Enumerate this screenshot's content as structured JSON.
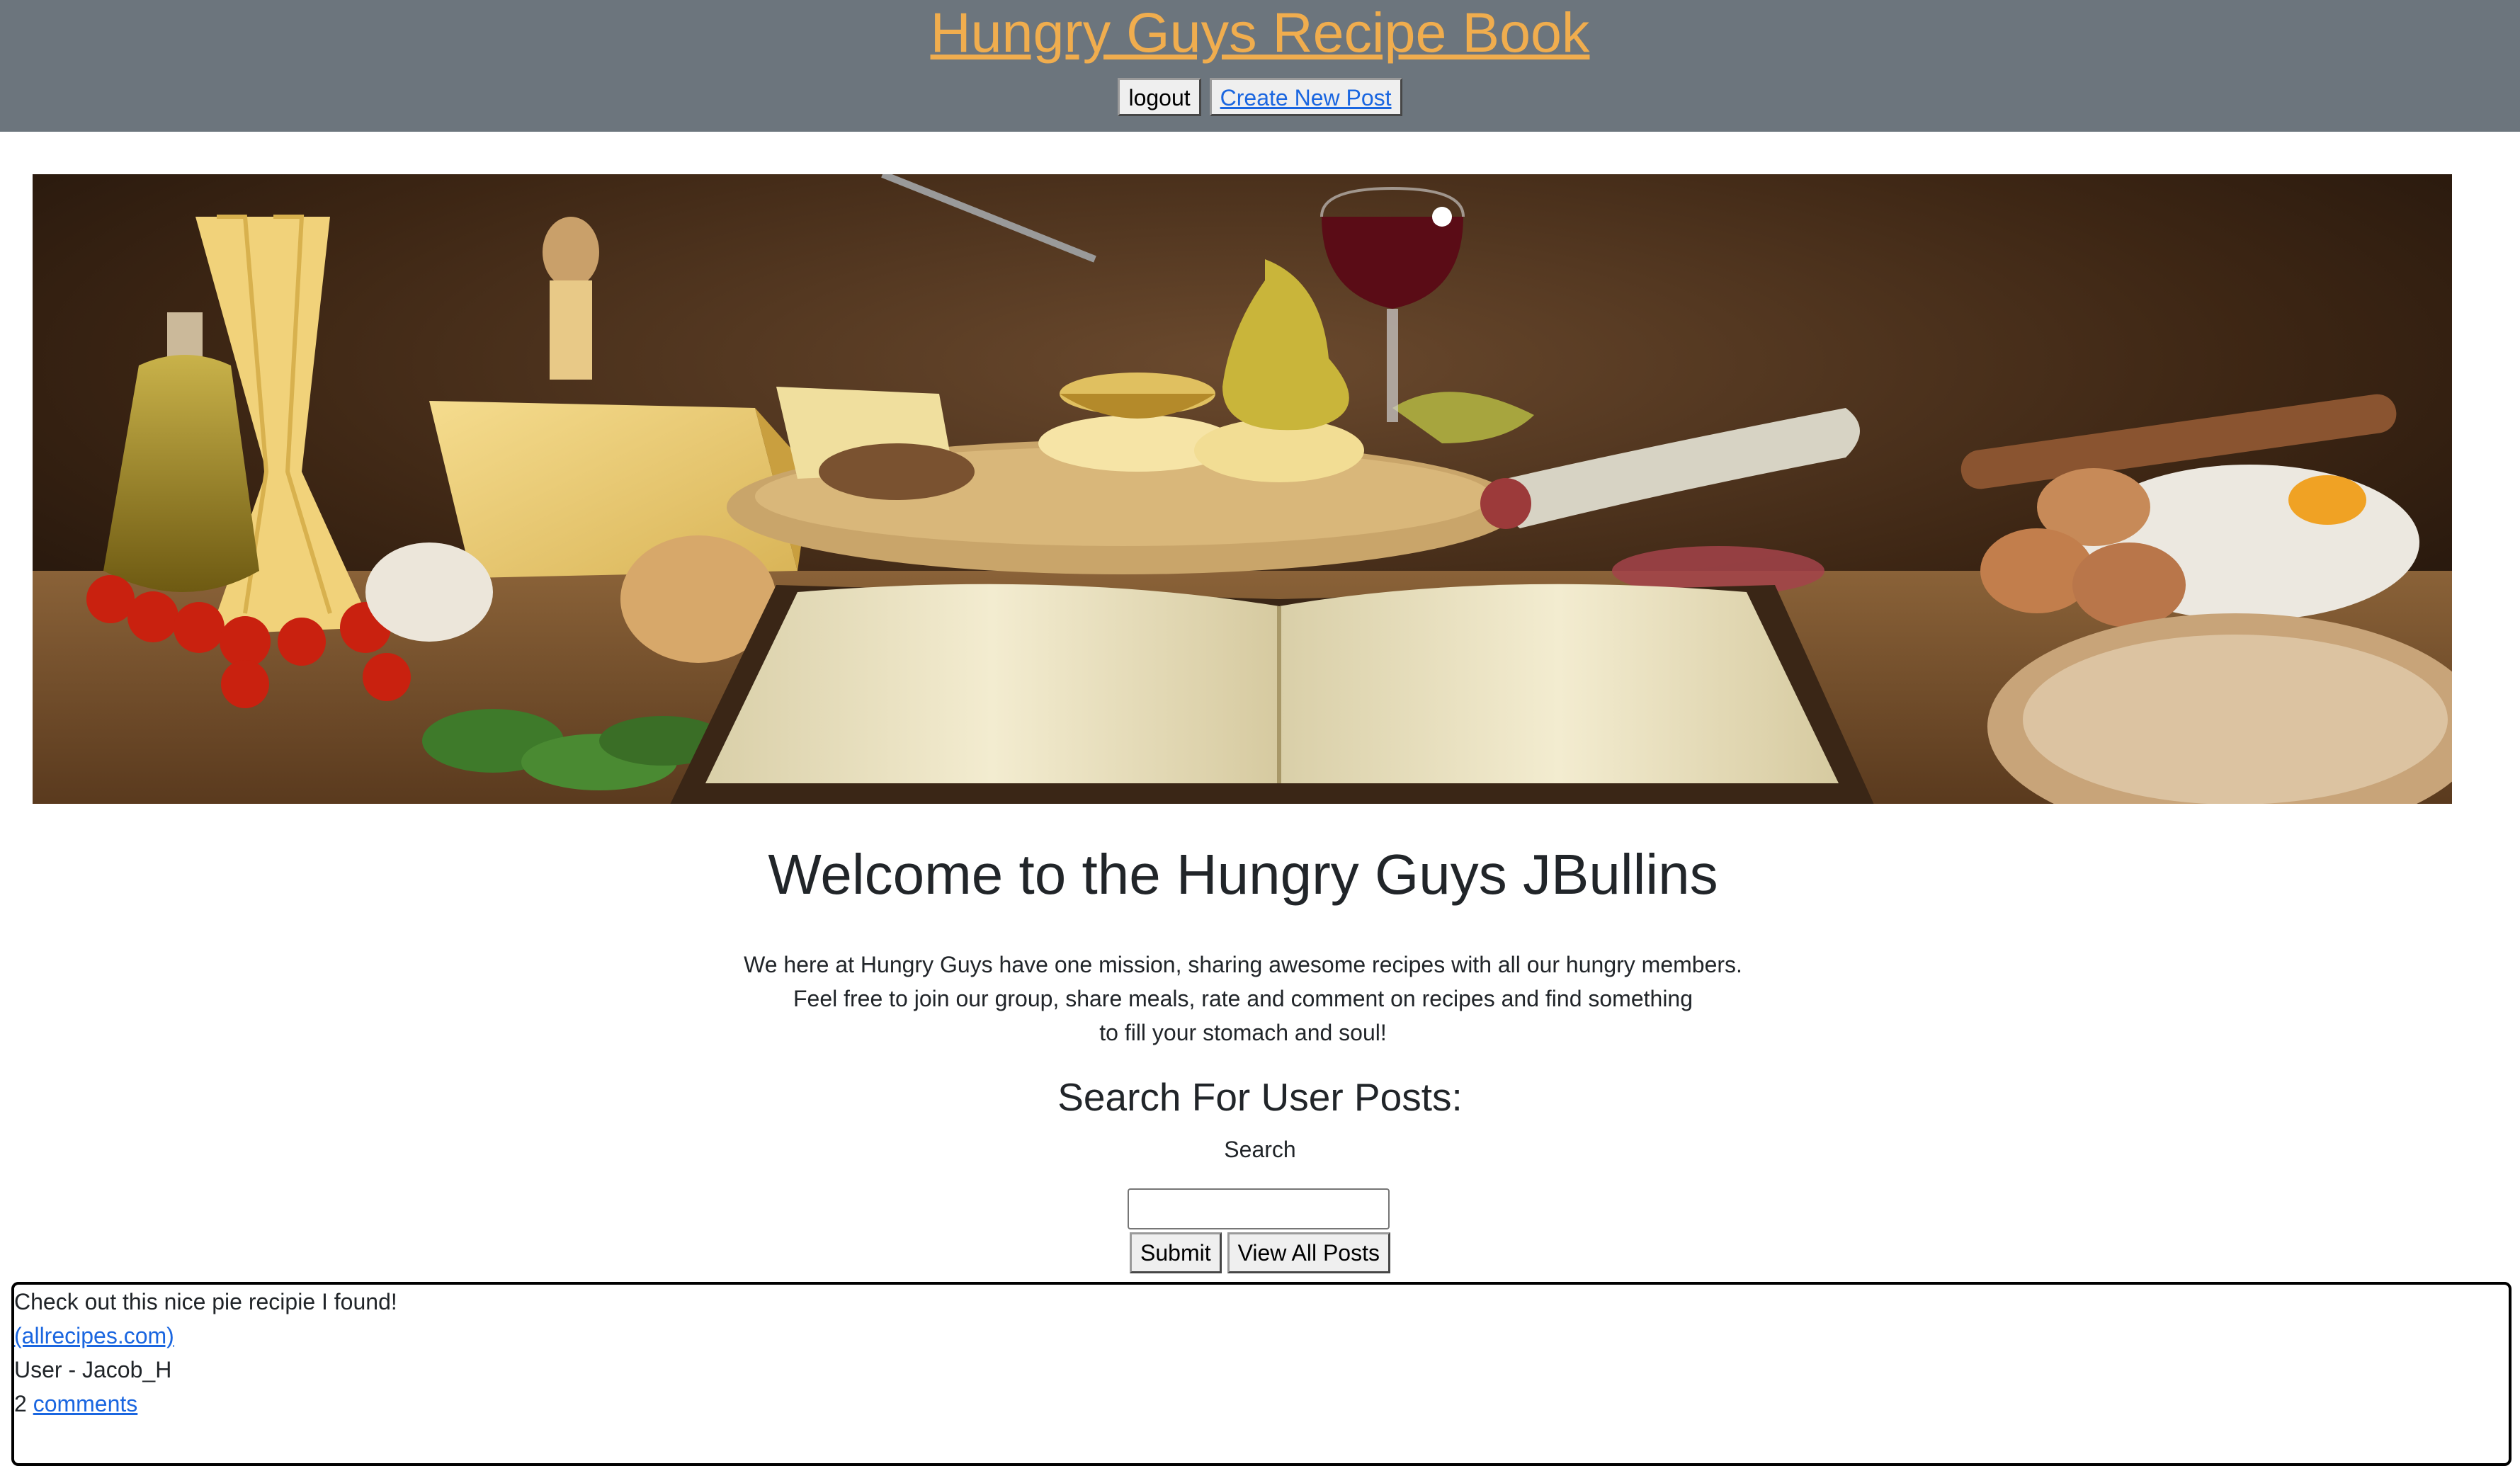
{
  "header": {
    "title": "Hungry Guys Recipe Book",
    "logout_label": "logout",
    "create_post_label": "Create New Post"
  },
  "banner": {
    "icon": "recipe-banner-image"
  },
  "welcome": {
    "heading": "Welcome to the Hungry Guys JBullins",
    "mission_lines": [
      "We here at Hungry Guys have one mission, sharing awesome recipes with all our hungry members.",
      "Feel free to join our group, share meals, rate and comment on recipes and find something",
      "to fill your stomach and soul!"
    ]
  },
  "search": {
    "heading": "Search For User Posts:",
    "label": "Search",
    "input_value": "",
    "submit_label": "Submit",
    "view_all_label": "View All Posts"
  },
  "posts": [
    {
      "text": "Check out this nice pie recipie I found!",
      "link": "(allrecipes.com)",
      "user": "User - Jacob_H",
      "comment_count": "2",
      "comments_label": "comments"
    }
  ],
  "colors": {
    "header_bg": "#6c757d",
    "title": "#f0ad4e",
    "link": "#1a66e0"
  }
}
